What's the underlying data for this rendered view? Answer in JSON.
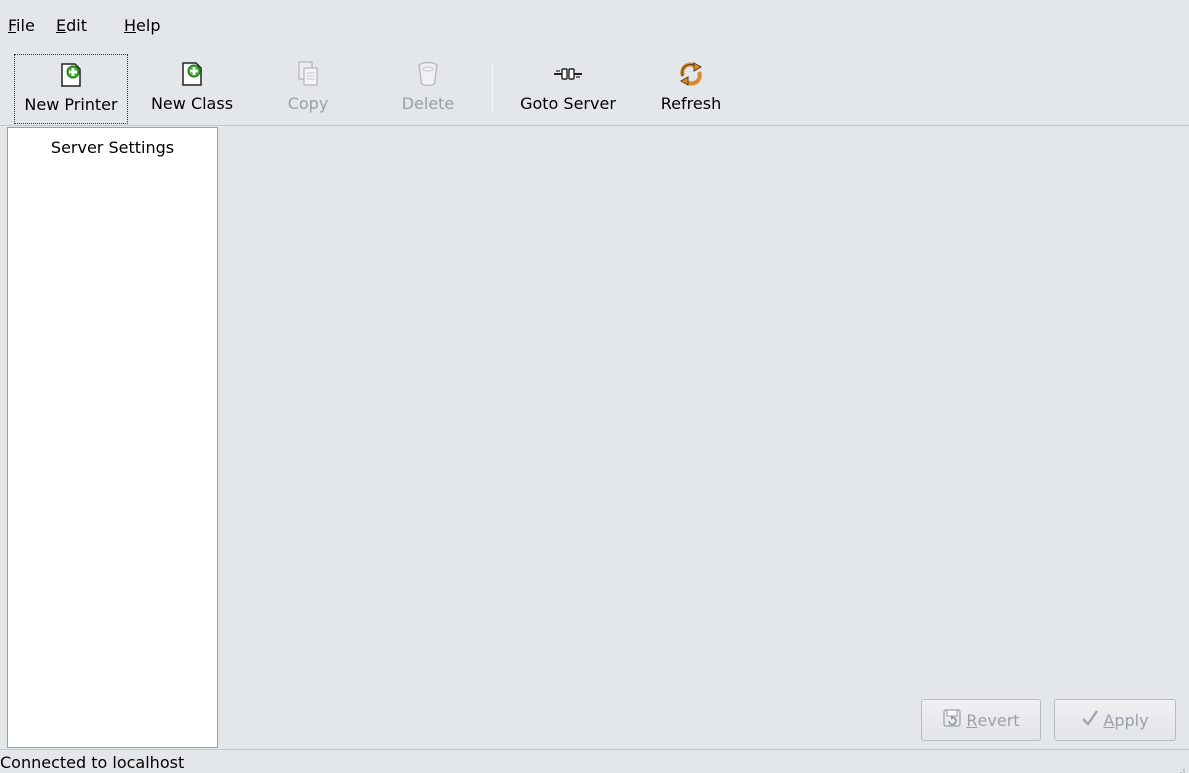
{
  "menubar": {
    "file": {
      "mnemonic": "F",
      "rest": "ile"
    },
    "edit": {
      "mnemonic": "E",
      "rest": "dit"
    },
    "help": {
      "mnemonic": "H",
      "rest": "elp"
    }
  },
  "toolbar": {
    "new_printer": {
      "label": "New Printer",
      "icon": "new-printer-icon"
    },
    "new_class": {
      "label": "New Class",
      "icon": "new-class-icon"
    },
    "copy": {
      "label": "Copy",
      "icon": "copy-icon"
    },
    "delete": {
      "label": "Delete",
      "icon": "trash-icon"
    },
    "goto_server": {
      "label": "Goto Server",
      "icon": "connector-icon"
    },
    "refresh": {
      "label": "Refresh",
      "icon": "refresh-icon"
    }
  },
  "sidebar": {
    "items": [
      {
        "label": "Server Settings"
      }
    ]
  },
  "buttons": {
    "revert": {
      "mnemonic": "R",
      "rest": "evert",
      "icon": "revert-icon"
    },
    "apply": {
      "mnemonic": "A",
      "rest": "pply",
      "icon": "checkmark-icon"
    }
  },
  "status": {
    "text": "Connected to localhost"
  },
  "colors": {
    "add_green": "#3fae2a",
    "disabled_text": "#9aa0a6",
    "refresh_orange": "#d98a2c"
  }
}
